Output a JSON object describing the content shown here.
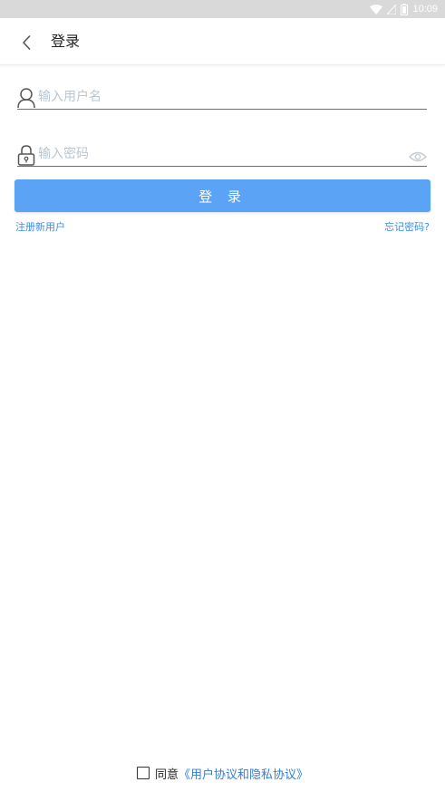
{
  "status_bar": {
    "time": "10:09"
  },
  "header": {
    "title": "登录"
  },
  "form": {
    "username_placeholder": "输入用户名",
    "password_placeholder": "输入密码",
    "login_label": "登 录"
  },
  "links": {
    "register": "注册新用户",
    "forgot": "忘记密码?"
  },
  "agreement": {
    "prefix": "同意",
    "link": "《用户协议和隐私协议》",
    "checked": false
  },
  "colors": {
    "accent": "#5aa3f5",
    "link": "#3b8ee6"
  },
  "icons": [
    "wifi-icon",
    "signal-icon",
    "battery-icon",
    "back-arrow-icon",
    "user-icon",
    "lock-icon",
    "eye-icon"
  ]
}
